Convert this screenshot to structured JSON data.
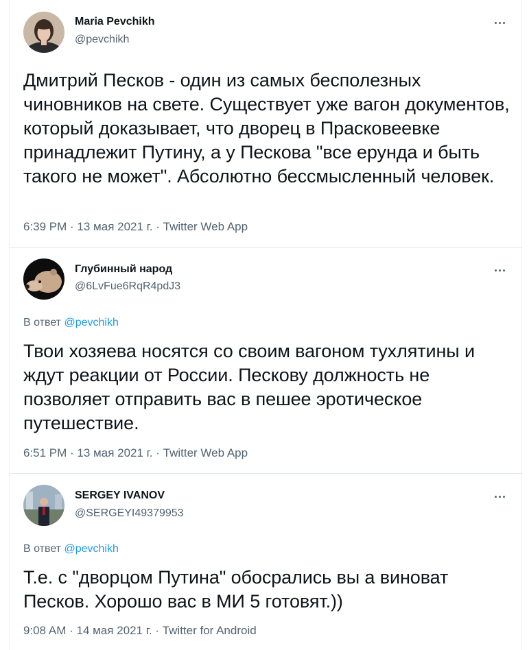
{
  "tweets": [
    {
      "author": {
        "name": "Maria Pevchikh",
        "handle": "@pevchikh",
        "avatar": "avatar-maria"
      },
      "reply_to": null,
      "text": "Дмитрий Песков - один из самых бесполезных чиновников на свете. Существует уже вагон документов, который доказывает, что дворец в Прасковеевке принадлежит Путину, а у Пескова \"все ерунда и быть такого не может\". Абсолютно бессмысленный человек.",
      "time": "6:39 PM",
      "date": "13 мая 2021 г.",
      "source": "Twitter Web App",
      "more_icon": "more-options-icon"
    },
    {
      "author": {
        "name": "Глубинный народ",
        "handle": "@6LvFue6RqR4pdJ3",
        "avatar": "avatar-bear"
      },
      "reply_to": {
        "prefix": "В ответ",
        "handle": "@pevchikh"
      },
      "text": "Твои хозяева носятся со своим вагоном тухлятины и ждут реакции от России. Пескову должность не позволяет отправить вас в пешее эротическое путешествие.",
      "time": "6:51 PM",
      "date": "13 мая 2021 г.",
      "source": "Twitter Web App",
      "more_icon": "more-options-icon"
    },
    {
      "author": {
        "name": "SERGEY IVANOV",
        "handle": "@SERGEYI49379953",
        "avatar": "avatar-sergey"
      },
      "reply_to": {
        "prefix": "В ответ",
        "handle": "@pevchikh"
      },
      "text": "Т.е. с \"дворцом Путина\" обосрались вы а виноват Песков.  Хорошо вас в МИ 5 готовят.))",
      "time": "9:08 AM",
      "date": "14 мая 2021 г.",
      "source": "Twitter for Android",
      "more_icon": "more-options-icon"
    }
  ],
  "separator": " · ",
  "colors": {
    "text": "#0f1419",
    "secondary": "#536471",
    "link": "#1d9bf0",
    "divider": "#e1e8ed"
  }
}
